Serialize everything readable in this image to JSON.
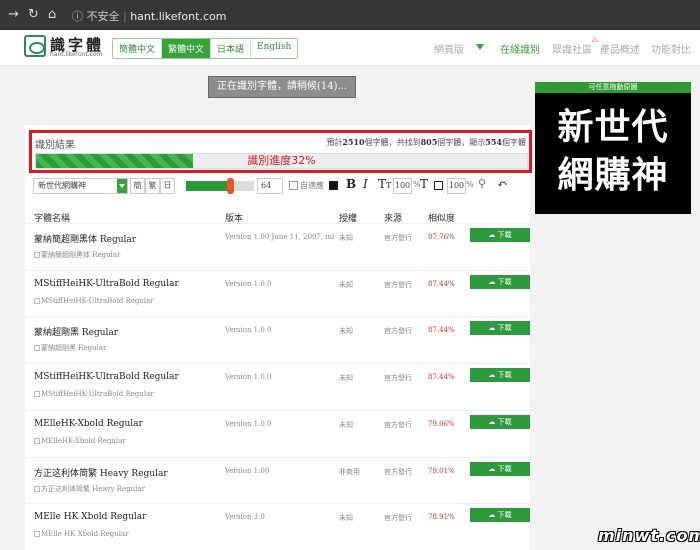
{
  "browser": {
    "url_warning": "不安全",
    "url": "hant.likefont.com"
  },
  "header": {
    "logo_title": "識字體",
    "logo_sub": "hant.likefont.com",
    "languages": [
      {
        "label": "簡體中文",
        "active": false
      },
      {
        "label": "繁體中文",
        "active": true
      },
      {
        "label": "日本語",
        "active": false
      },
      {
        "label": "English",
        "active": false
      }
    ],
    "nav": {
      "home": "網頁版",
      "online": "在綫識別",
      "community": "眾識社區",
      "overview": "產品概述",
      "features": "功能對比"
    }
  },
  "progress_button": "正在識別字體，請稍候(14)...",
  "ad": {
    "top_text": "可任意拖動原圖",
    "lines": [
      "新世代",
      "網購神"
    ]
  },
  "result": {
    "title": "識別結果",
    "stats_prefix": "預計",
    "stats_total": "2510",
    "stats_mid": "個字體，共找到",
    "stats_found": "805",
    "stats_mid2": "個字體，顯示",
    "stats_shown": "554",
    "stats_suffix": "個字體",
    "progress_text": "識別進度32%",
    "progress": 0.32
  },
  "toolbar": {
    "font_select": "新世代網購神",
    "script_buttons": [
      "簡",
      "繁",
      "日"
    ],
    "size_value": "64",
    "size_level": 0.64,
    "auto_fit": "自適應",
    "bold": "B",
    "italic": "I",
    "tt": "T",
    "num1": "100",
    "num2": "100",
    "percent": "%",
    "undo": "↶"
  },
  "table": {
    "headers": [
      "字體名稱",
      "版本",
      "授權",
      "來源",
      "相似度"
    ],
    "download_label": "下載",
    "rows": [
      {
        "name": "蒙納簡超剛黑体 Regular",
        "version": "Version 1.00 June 11, 2007, initial...",
        "license": "未知",
        "source": "官方發行",
        "similarity": "87.76%",
        "preview": "蒙納簡超剛黑体 Regular"
      },
      {
        "name": "MStiffHeiHK-UltraBold Regular",
        "version": "Version 1.0.0",
        "license": "未知",
        "source": "官方發行",
        "similarity": "87.44%",
        "preview": "MStiffHeiHK-UltraBold Regular"
      },
      {
        "name": "蒙納超剛黑 Regular",
        "version": "Version 1.0.0",
        "license": "未知",
        "source": "官方發行",
        "similarity": "87.44%",
        "preview": "蒙納超剛黑 Regular"
      },
      {
        "name": "MStiffHeiHK-UltraBold Regular",
        "version": "Version 1.0.0",
        "license": "未知",
        "source": "官方發行",
        "similarity": "87.44%",
        "preview": "MStiffHeiHK-UltraBold Regular"
      },
      {
        "name": "MElleHK-Xbold Regular",
        "version": "Version 1.0.0",
        "license": "未知",
        "source": "官方發行",
        "similarity": "79.06%",
        "preview": "MElleHK-Xbold Regular"
      },
      {
        "name": "方正这利体简繁 Heavy Regular",
        "version": "Version 1.00",
        "license": "非商用",
        "source": "官方發行",
        "similarity": "79.01%",
        "preview": "方正达利体简繁 Heavy Regular"
      },
      {
        "name": "MElle HK Xbold Regular",
        "version": "Version 3.0",
        "license": "未知",
        "source": "官方發行",
        "similarity": "78.91%",
        "preview": "MElle HK Xbold Regular"
      }
    ]
  },
  "watermark": "minwt.com"
}
